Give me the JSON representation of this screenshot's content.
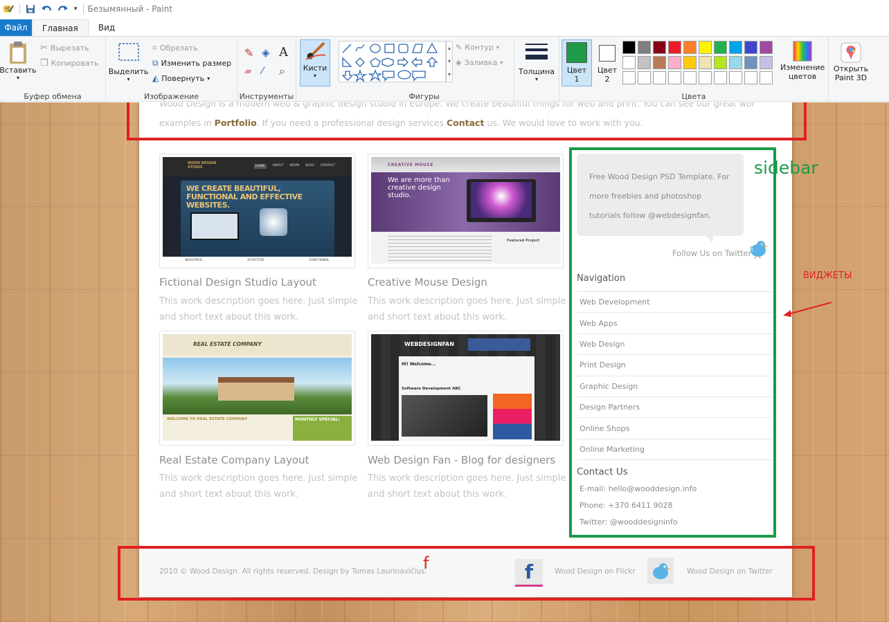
{
  "window": {
    "title": "Безымянный - Paint"
  },
  "tabs": [
    "Файл",
    "Главная",
    "Вид"
  ],
  "ribbon": {
    "clipboard": {
      "paste": "Вставить",
      "cut": "Вырезать",
      "copy": "Копировать",
      "label": "Буфер обмена"
    },
    "image": {
      "select": "Выделить",
      "crop": "Обрезать",
      "resize": "Изменить размер",
      "rotate": "Повернуть",
      "label": "Изображение"
    },
    "tools": {
      "label": "Инструменты"
    },
    "brushes": {
      "label": "Кисти"
    },
    "shapes": {
      "outline": "Контур",
      "fill": "Заливка",
      "label": "Фигуры"
    },
    "size": {
      "label": "Толщина"
    },
    "colors": {
      "color1": "Цвет",
      "color1_num": "1",
      "color2": "Цвет",
      "color2_num": "2",
      "edit": "Изменение цветов",
      "label": "Цвета",
      "active_color1": "#1e9a48",
      "palette_row1": [
        "#000000",
        "#7f7f7f",
        "#880015",
        "#ed1c24",
        "#ff7f27",
        "#fff200",
        "#22b14c",
        "#00a2e8",
        "#3f48cc",
        "#a349a4"
      ],
      "palette_row2": [
        "#ffffff",
        "#c3c3c3",
        "#b97a57",
        "#ffaec9",
        "#ffc90e",
        "#efe4b0",
        "#b5e61d",
        "#99d9ea",
        "#7092be",
        "#c8bfe7"
      ],
      "palette_row3": [
        "#ffffff",
        "#ffffff",
        "#ffffff",
        "#ffffff",
        "#ffffff",
        "#ffffff",
        "#ffffff",
        "#ffffff",
        "#ffffff",
        "#ffffff"
      ]
    },
    "paint3d": "Открыть Paint 3D"
  },
  "page": {
    "intro_line1": "Wood Design is a modern web & graphic design studio in Europe. We create beautiful things for web and print. You can see our great work",
    "intro_line2_pre": "examples in",
    "intro_portfolio": "Portfolio",
    "intro_line2_mid": ". If you need a professional design services",
    "intro_contact": "Contact",
    "intro_line2_post": "us. We would love to work with you.",
    "portfolio": [
      {
        "title": "Fictional Design Studio Layout",
        "desc": "This work description goes here. Just simple and short text about this work."
      },
      {
        "title": "Creative Mouse Design",
        "desc": "This work description goes here. Just simple and short text about this work."
      },
      {
        "title": "Real Estate Company Layout",
        "desc": "This work description goes here. Just simple and short text about this work."
      },
      {
        "title": "Web Design Fan - Blog for designers",
        "desc": "This work description goes here. Just simple and short text about this work."
      }
    ],
    "thumbs": {
      "t1_headline": "WE CREATE BEAUTIFUL, FUNCTIONAL AND EFFECTIVE WEBSITES.",
      "t1_logo": "WOOD DESIGN STUDIO",
      "t1_nav": [
        "HOME",
        "ABOUT",
        "WORK",
        "BLOG",
        "CONTACT"
      ],
      "t1_footer": [
        "BEAUTIFUL",
        "EFFECTIVE",
        "FUNCTIONAL"
      ],
      "t2_logo": "CREATIVE MOUSE",
      "t2_headline": "We are more than creative design studio.",
      "t2_featured": "Featured Project",
      "t3_logo": "REAL ESTATE COMPANY",
      "t3_welcome": "WELCOME TO REAL ESTATE COMPANY",
      "t3_special": "MONTHLY SPECIAL:",
      "t4_logo": "WEBDESIGNFAN",
      "t4_hi": "Hi! Welcome...",
      "t4_post": "Software Development ABC"
    },
    "sidebar": {
      "tweet": "Free Wood Design PSD Template. For more freebies and photoshop tutorials follow @webdesignfan.",
      "follow": "Follow Us on Twitter",
      "nav_heading": "Navigation",
      "nav_items": [
        "Web Development",
        "Web Apps",
        "Web Design",
        "Print Design",
        "Graphic Design",
        "Design Partners",
        "Online Shops",
        "Online Marketing"
      ],
      "contact_heading": "Contact Us",
      "email": "E-mail: hello@wooddesign.info",
      "phone": "Phone: +370 6411 9028",
      "twitter": "Twitter: @wooddesigninfo"
    },
    "footer": {
      "copyright": "2010 © Wood Design. All rights reserved. Design by Tomas Laurinavičius.",
      "flickr": "Wood Design on Flickr",
      "twitter": "Wood Design on Twitter"
    }
  },
  "annotations": {
    "sidebar": "sidebar",
    "widgets": "ВИДЖЕТЫ",
    "footer": "f",
    "red": "#e02020",
    "green": "#1b9a4a"
  }
}
